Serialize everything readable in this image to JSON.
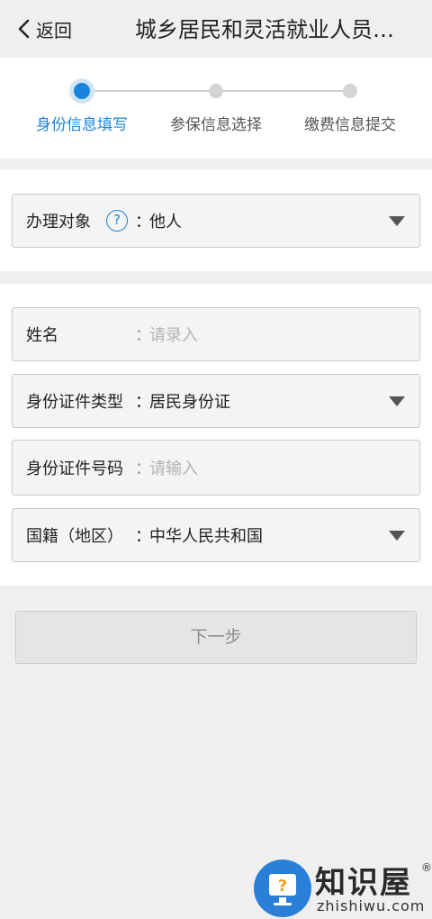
{
  "header": {
    "back_label": "返回",
    "title": "城乡居民和灵活就业人员…"
  },
  "steps": [
    {
      "label": "身份信息填写",
      "active": true
    },
    {
      "label": "参保信息选择",
      "active": false
    },
    {
      "label": "缴费信息提交",
      "active": false
    }
  ],
  "target": {
    "label": "办理对象",
    "help_glyph": "?",
    "colon": "：",
    "value": "他人"
  },
  "form": {
    "name": {
      "label": "姓名",
      "colon": "：",
      "placeholder": "请录入"
    },
    "id_type": {
      "label": "身份证件类型",
      "colon": "：",
      "value": "居民身份证"
    },
    "id_number": {
      "label": "身份证件号码",
      "colon": "：",
      "placeholder": "请输入"
    },
    "nationality": {
      "label": "国籍（地区）",
      "colon": "：",
      "value": "中华人民共和国"
    }
  },
  "next_button": {
    "label": "下一步"
  },
  "watermark": {
    "text": "知识屋",
    "sub": "zhishiwu.com",
    "reg": "®",
    "badge_glyph": "?"
  },
  "colors": {
    "accent": "#1a84dd",
    "inactive": "#d4d4d4",
    "background": "#efefef"
  }
}
